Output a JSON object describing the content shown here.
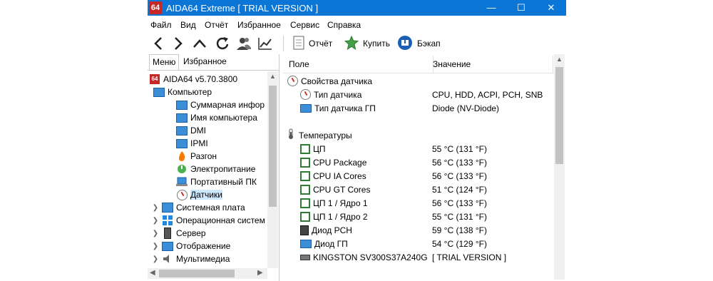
{
  "window": {
    "app_icon_text": "64",
    "title": "AIDA64 Extreme  [ TRIAL VERSION ]",
    "minimize": "—",
    "maximize": "☐",
    "close": "✕"
  },
  "menu": [
    "Файл",
    "Вид",
    "Отчёт",
    "Избранное",
    "Сервис",
    "Справка"
  ],
  "toolbar": {
    "nav_icons": [
      "back-icon",
      "forward-icon",
      "up-icon",
      "refresh-icon",
      "users-icon",
      "chart-icon"
    ],
    "report_label": "Отчёт",
    "buy_label": "Купить",
    "backup_label": "Бэкап"
  },
  "left_tabs": [
    "Меню",
    "Избранное"
  ],
  "tree": [
    {
      "label": "AIDA64 v5.70.3800",
      "icon": "aida-icon",
      "level": 0
    },
    {
      "label": "Компьютер",
      "icon": "computer-icon",
      "level": 0,
      "expanded": true
    },
    {
      "label": "Суммарная инфор",
      "icon": "monitor-icon",
      "level": 1
    },
    {
      "label": "Имя компьютера",
      "icon": "monitor-icon",
      "level": 1
    },
    {
      "label": "DMI",
      "icon": "monitor-icon",
      "level": 1
    },
    {
      "label": "IPMI",
      "icon": "monitor-icon",
      "level": 1
    },
    {
      "label": "Разгон",
      "icon": "flame-icon",
      "level": 1
    },
    {
      "label": "Электропитание",
      "icon": "power-icon",
      "level": 1
    },
    {
      "label": "Портативный ПК",
      "icon": "laptop-icon",
      "level": 1
    },
    {
      "label": "Датчики",
      "icon": "gauge-icon",
      "level": 1,
      "selected": true
    },
    {
      "label": "Системная плата",
      "icon": "motherboard-icon",
      "level": 0,
      "collapsed": true
    },
    {
      "label": "Операционная систем",
      "icon": "windows-icon",
      "level": 0,
      "collapsed": true
    },
    {
      "label": "Сервер",
      "icon": "server-icon",
      "level": 0,
      "collapsed": true
    },
    {
      "label": "Отображение",
      "icon": "display-icon",
      "level": 0,
      "collapsed": true
    },
    {
      "label": "Мультимедиа",
      "icon": "speaker-icon",
      "level": 0,
      "collapsed": true
    }
  ],
  "columns": {
    "field": "Поле",
    "value": "Значение"
  },
  "rows": [
    {
      "type": "group",
      "field": "Свойства датчика",
      "icon": "gauge-icon"
    },
    {
      "type": "item",
      "field": "Тип датчика",
      "value": "CPU, HDD, ACPI, PCH, SNB",
      "icon": "gauge-icon"
    },
    {
      "type": "item",
      "field": "Тип датчика ГП",
      "value": "Diode  (NV-Diode)",
      "icon": "monitor-icon"
    },
    {
      "type": "blank"
    },
    {
      "type": "group",
      "field": "Температуры",
      "icon": "thermometer-icon"
    },
    {
      "type": "item",
      "field": "ЦП",
      "value": "55 °C  (131 °F)",
      "icon": "cpu-icon"
    },
    {
      "type": "item",
      "field": "CPU Package",
      "value": "56 °C  (133 °F)",
      "icon": "cpu-icon"
    },
    {
      "type": "item",
      "field": "CPU IA Cores",
      "value": "56 °C  (133 °F)",
      "icon": "cpu-icon"
    },
    {
      "type": "item",
      "field": "CPU GT Cores",
      "value": "51 °C  (124 °F)",
      "icon": "cpu-icon"
    },
    {
      "type": "item",
      "field": "ЦП 1 / Ядро 1",
      "value": "56 °C  (133 °F)",
      "icon": "cpu-icon"
    },
    {
      "type": "item",
      "field": "ЦП 1 / Ядро 2",
      "value": "55 °C  (131 °F)",
      "icon": "cpu-icon"
    },
    {
      "type": "item",
      "field": "Диод PCH",
      "value": "59 °C  (138 °F)",
      "icon": "chip-icon"
    },
    {
      "type": "item",
      "field": "Диод ГП",
      "value": "54 °C  (129 °F)",
      "icon": "monitor-icon"
    },
    {
      "type": "item",
      "field": "KINGSTON SV300S37A240G",
      "value": "[ TRIAL VERSION ]",
      "icon": "drive-icon"
    }
  ],
  "colors": {
    "titlebar": "#0b76d6",
    "selection": "#cde8ff",
    "cpu_icon": "#2e7d32"
  }
}
